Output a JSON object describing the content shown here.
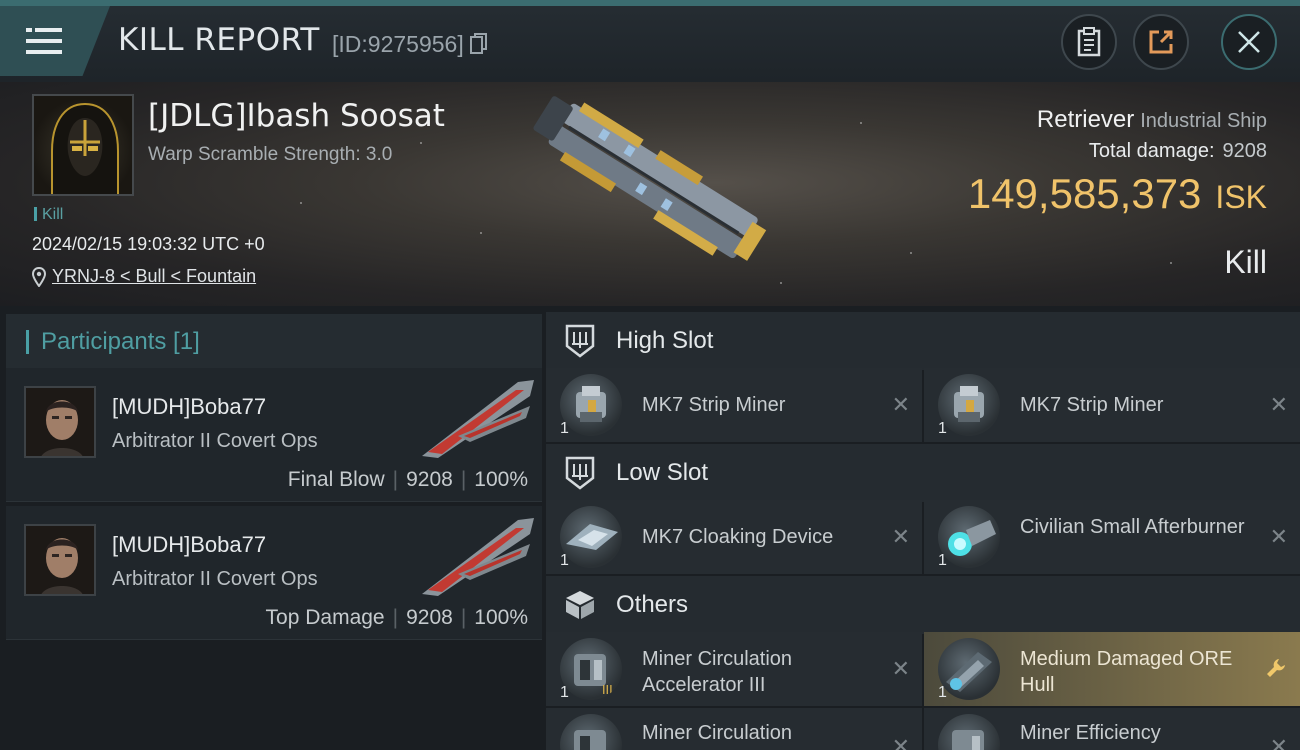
{
  "topbar": {
    "title": "KILL REPORT",
    "report_id": "[ID:9275956]",
    "icons": [
      "menu-icon",
      "copy-icon",
      "clipboard-icon",
      "share-icon",
      "close-icon"
    ]
  },
  "victim": {
    "name": "[JDLG]Ibash Soosat",
    "subtitle": "Warp Scramble Strength: 3.0",
    "tag": "Kill",
    "datetime": "2024/02/15 19:03:32 UTC +0",
    "location": "YRNJ-8 < Bull < Fountain"
  },
  "ship": {
    "name": "Retriever",
    "class": "Industrial Ship",
    "total_damage_label": "Total damage:",
    "total_damage_value": "9208",
    "isk_value": "149,585,373",
    "isk_unit": "ISK",
    "result": "Kill"
  },
  "participants": {
    "title": "Participants [1]",
    "rows": [
      {
        "name": "[MUDH]Boba77",
        "ship": "Arbitrator II Covert Ops",
        "role": "Final Blow",
        "damage": "9208",
        "percent": "100%"
      },
      {
        "name": "[MUDH]Boba77",
        "ship": "Arbitrator II Covert Ops",
        "role": "Top Damage",
        "damage": "9208",
        "percent": "100%"
      }
    ]
  },
  "slots": {
    "high": {
      "title": "High Slot",
      "items": [
        {
          "name": "MK7 Strip Miner",
          "qty": "1"
        },
        {
          "name": "MK7 Strip Miner",
          "qty": "1"
        }
      ]
    },
    "low": {
      "title": "Low Slot",
      "items": [
        {
          "name": "MK7 Cloaking Device",
          "qty": "1"
        },
        {
          "name": "Civilian Small Afterburner",
          "qty": "1"
        }
      ]
    },
    "others": {
      "title": "Others",
      "items": [
        {
          "name": "Miner Circulation Accelerator III",
          "qty": "1"
        },
        {
          "name": "Medium Damaged ORE Hull",
          "qty": "1"
        },
        {
          "name": "Miner Circulation",
          "qty": ""
        },
        {
          "name": "Miner Efficiency",
          "qty": ""
        }
      ]
    }
  },
  "colors": {
    "accent_teal": "#4f9ea2",
    "isk_gold": "#f0c36a",
    "highlight_item": "#8a7a4e"
  }
}
